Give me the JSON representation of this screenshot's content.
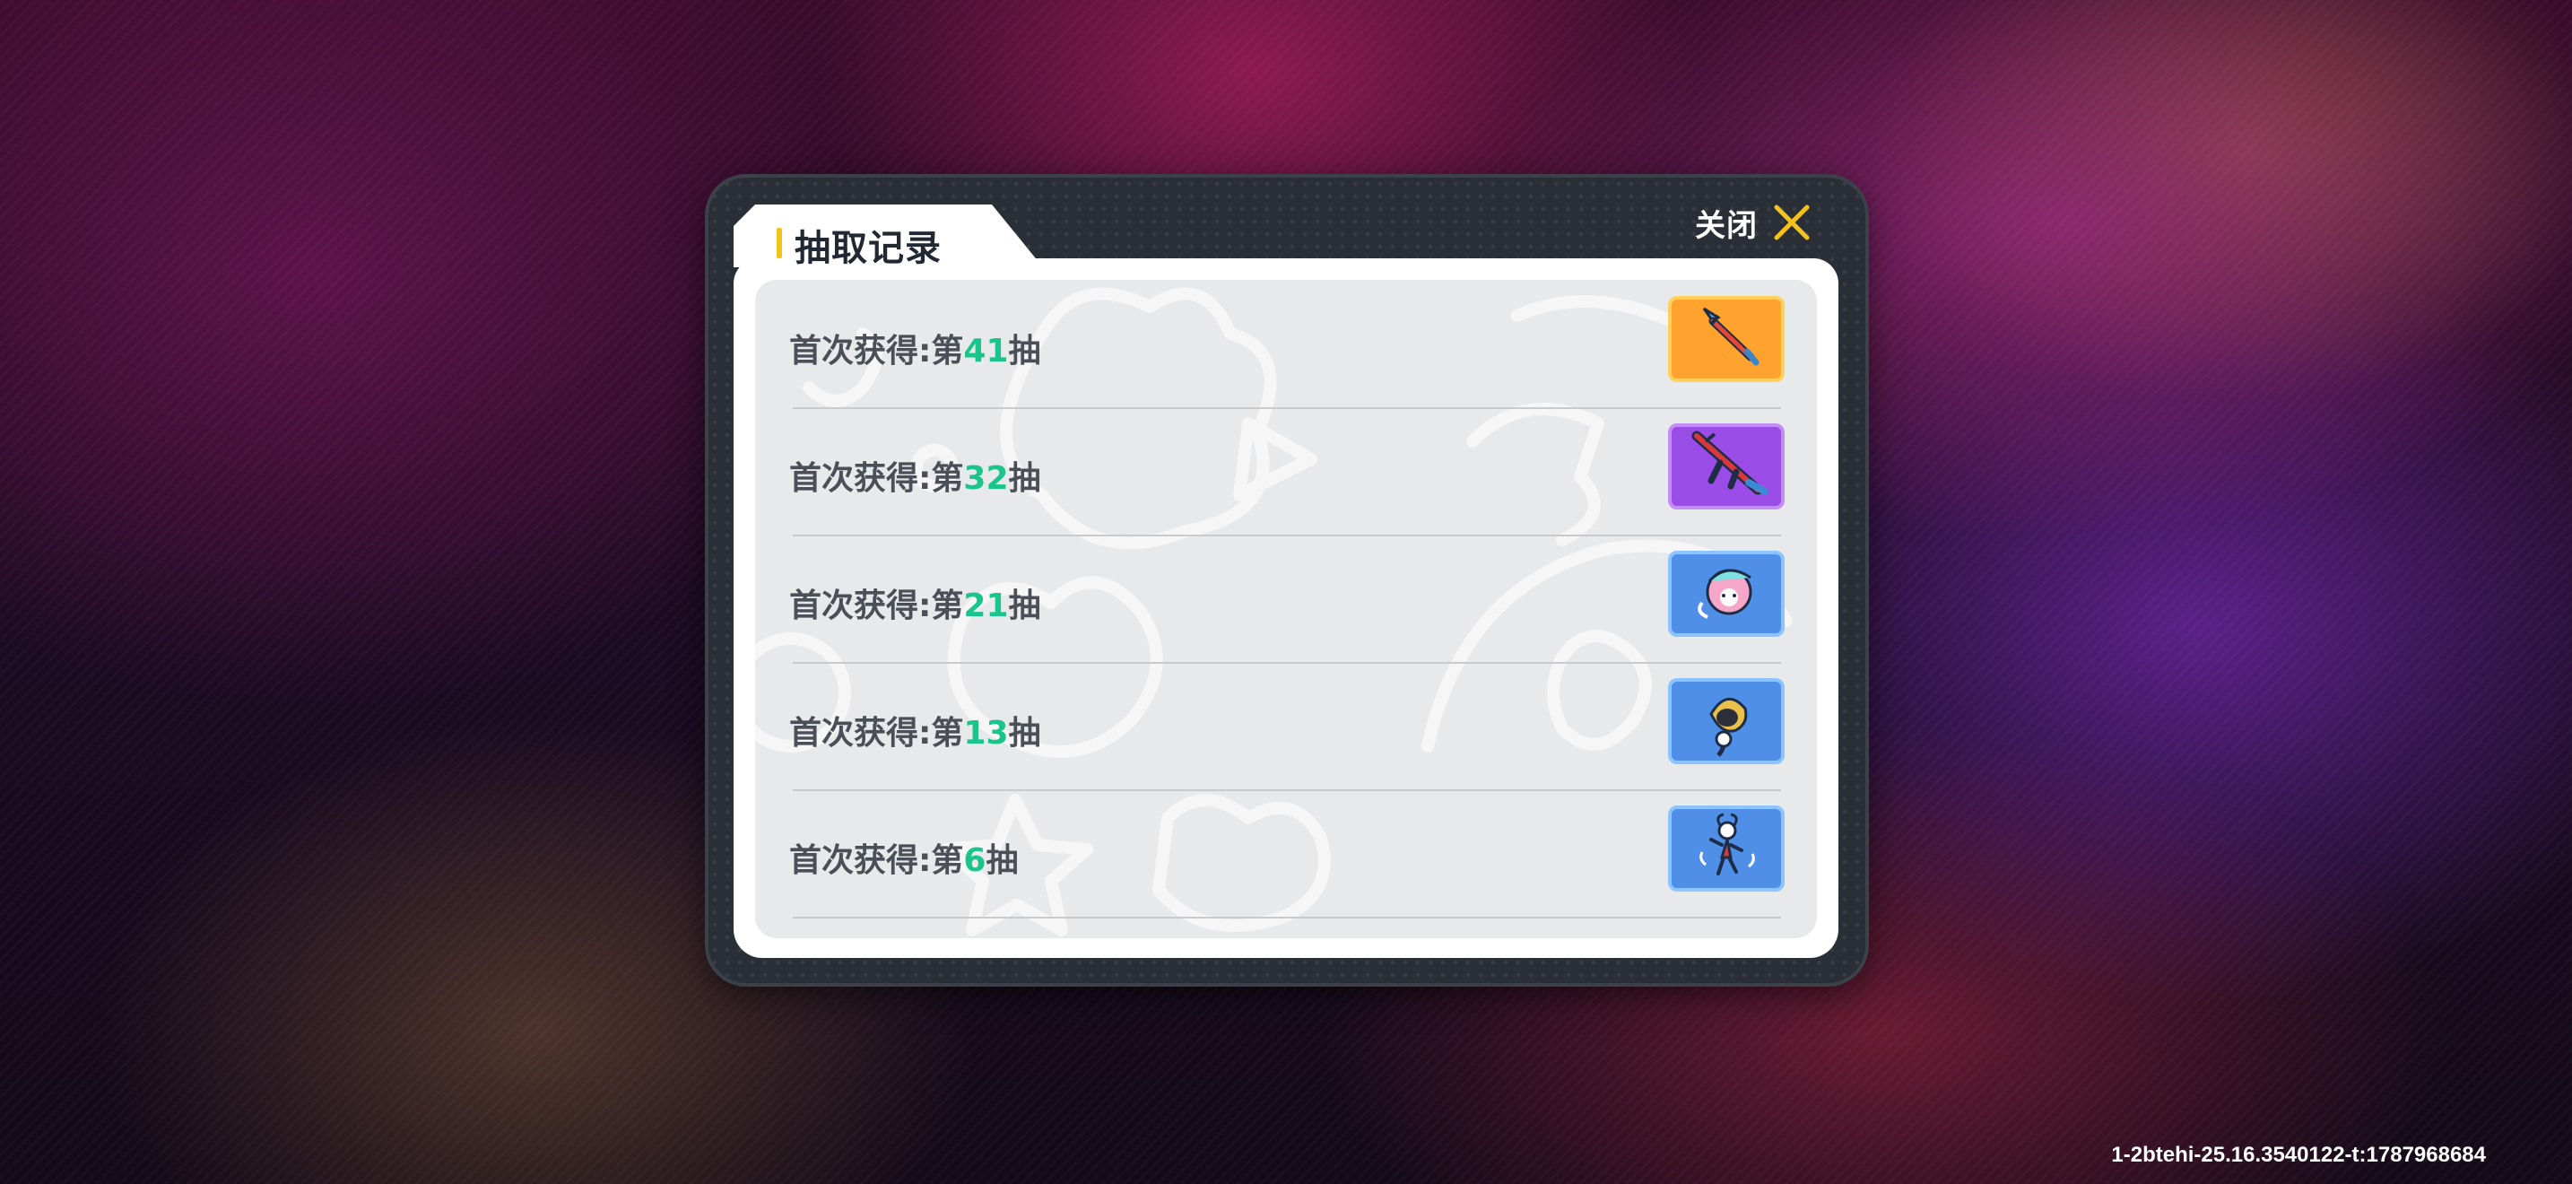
{
  "dialog": {
    "title": "抽取记录",
    "close_label": "关闭"
  },
  "records": [
    {
      "prefix": "首次获得:第",
      "number": "41",
      "suffix": "抽",
      "item_icon": "spear-icon",
      "rarity_color": "#ffa22e"
    },
    {
      "prefix": "首次获得:第",
      "number": "32",
      "suffix": "抽",
      "item_icon": "rifle-icon",
      "rarity_color": "#9a4de6"
    },
    {
      "prefix": "首次获得:第",
      "number": "21",
      "suffix": "抽",
      "item_icon": "pink-hair-character-icon",
      "rarity_color": "#4f8fe8"
    },
    {
      "prefix": "首次获得:第",
      "number": "13",
      "suffix": "抽",
      "item_icon": "blonde-character-icon",
      "rarity_color": "#4f8fe8"
    },
    {
      "prefix": "首次获得:第",
      "number": "6",
      "suffix": "抽",
      "item_icon": "dancing-character-icon",
      "rarity_color": "#4f8fe8"
    }
  ],
  "footer": {
    "version": "1-2btehi-25.16.3540122-t:1787968684"
  },
  "colors": {
    "accent_number": "#19c58a",
    "title_marker": "#f4c21a",
    "close_icon": "#f4c21a"
  }
}
